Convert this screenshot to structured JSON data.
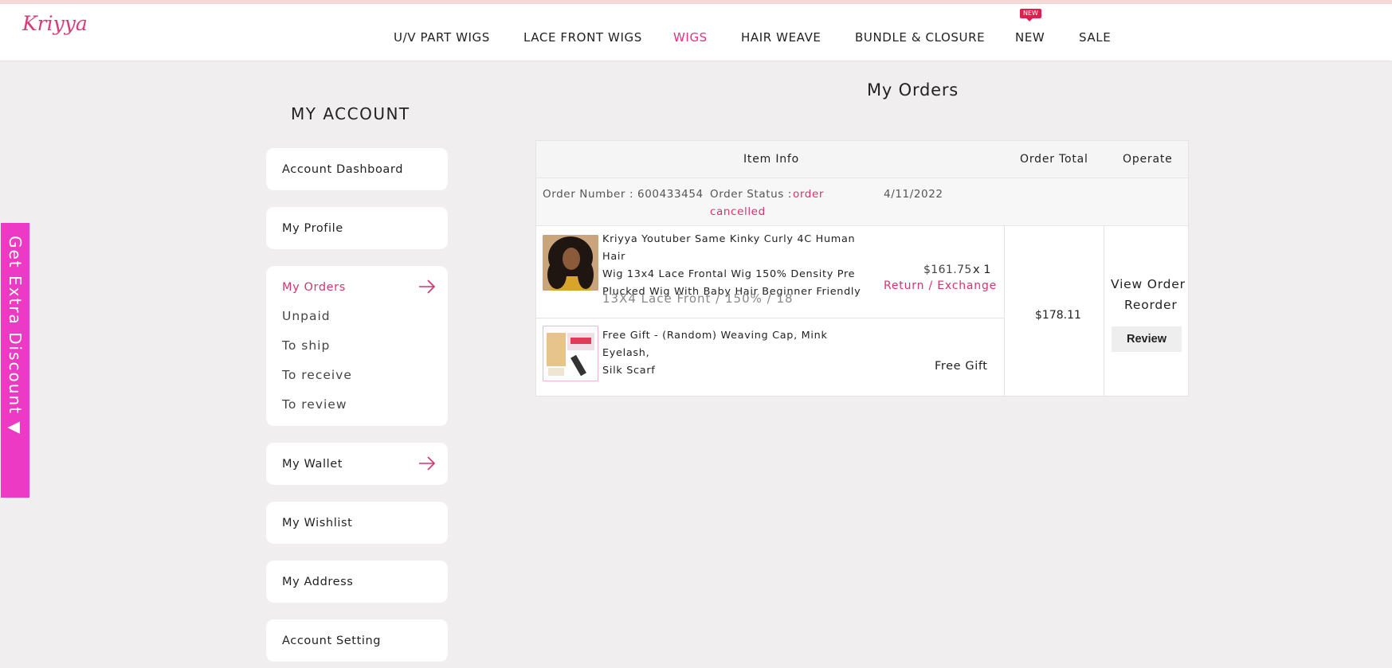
{
  "header": {
    "logo": "Kriyya",
    "nav": [
      {
        "label": "U/V PART WIGS"
      },
      {
        "label": "LACE FRONT WIGS"
      },
      {
        "label": "WIGS"
      },
      {
        "label": "HAIR WEAVE"
      },
      {
        "label": "BUNDLE & CLOSURE"
      },
      {
        "label": "NEW"
      },
      {
        "label": "SALE"
      }
    ],
    "active_nav": "WIGS",
    "new_badge": "NEW"
  },
  "side_promo": {
    "label": "Get Extra Discount ▼"
  },
  "account": {
    "title": "MY ACCOUNT",
    "menu": [
      {
        "label": "Account Dashboard"
      },
      {
        "label": "My Profile"
      },
      {
        "label": "My Orders"
      },
      {
        "label": "My Wallet"
      },
      {
        "label": "My Wishlist"
      },
      {
        "label": "My Address"
      },
      {
        "label": "Account Setting"
      }
    ],
    "orders_submenu": [
      "Unpaid",
      "To ship",
      "To receive",
      "To review"
    ]
  },
  "orders": {
    "title": "My Orders",
    "columns": [
      "Item Info",
      "Order Total",
      "Operate"
    ],
    "order": {
      "number_label": "Order Number : 600433454",
      "status_label": "Order Status : ",
      "status_line1": "order",
      "status_line2": "cancelled",
      "date": "4/11/2022",
      "items": [
        {
          "name_lines": [
            "Kriyya Youtuber Same Kinky Curly 4C Human Hair",
            "Wig 13x4 Lace Frontal Wig 150% Density Pre",
            "Plucked Wig With Baby Hair Beginner Friendly"
          ],
          "variant": "13X4 Lace Front / 150% / 18",
          "price": "$161.75",
          "qty": "x 1",
          "action": "Return / Exchange"
        },
        {
          "name_lines": [
            "Free Gift - (Random) Weaving Cap, Mink Eyelash,",
            "Silk Scarf"
          ],
          "price_label": "Free Gift"
        }
      ],
      "total": "$178.11",
      "operations": [
        "View Order",
        "Reorder",
        "Review"
      ]
    }
  },
  "colors": {
    "accent": "#e3317e",
    "promo": "#ec3ac5",
    "status": "#d6336c",
    "background": "#f1eeef"
  }
}
